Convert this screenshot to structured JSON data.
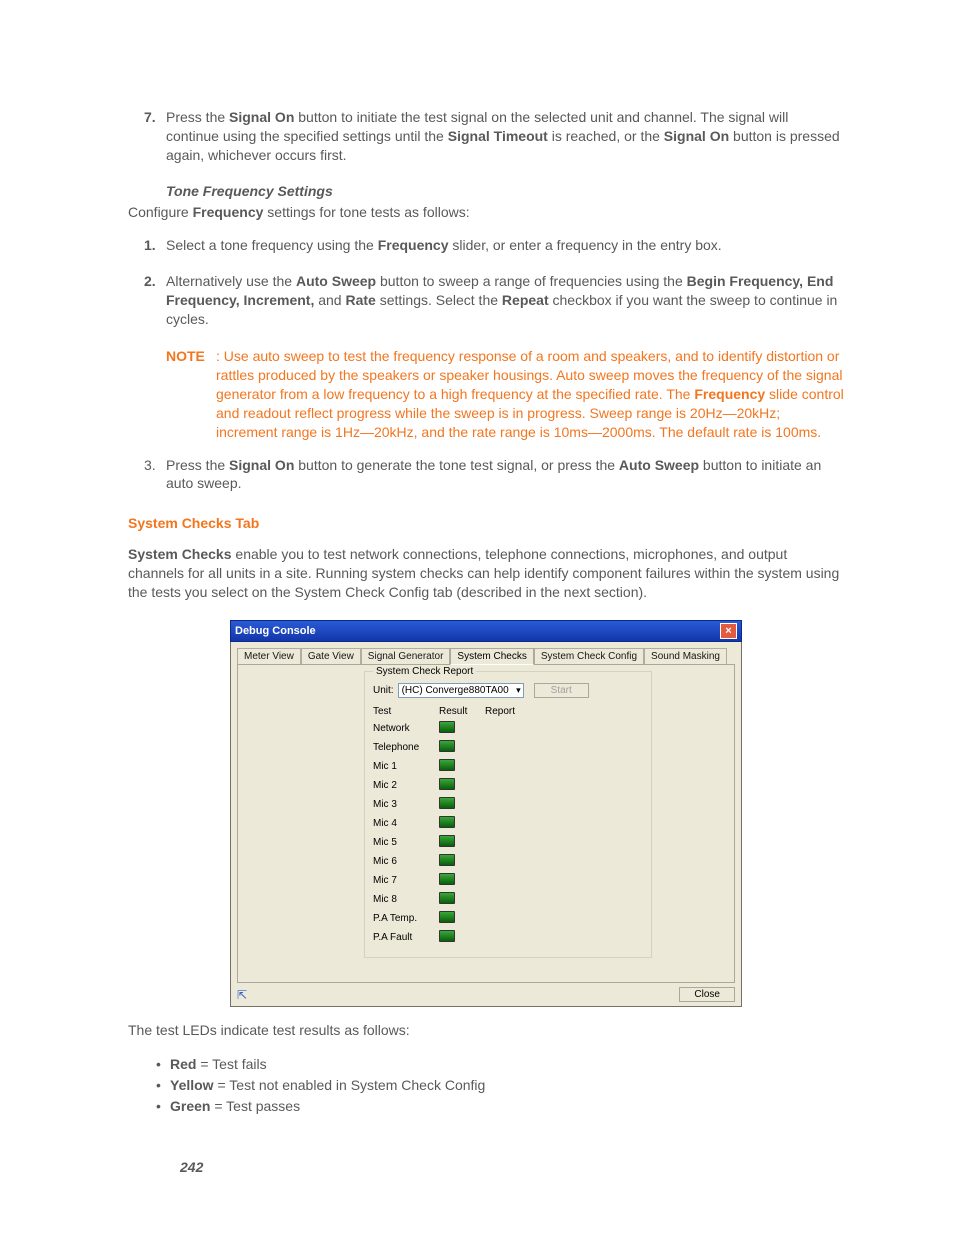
{
  "step7": {
    "num": "7.",
    "pre": "Press the ",
    "b1": "Signal On",
    "mid1": " button to initiate the test signal on the selected unit and channel. The signal will continue using the specified settings until the ",
    "b2": "Signal Timeout",
    "mid2": " is reached, or the ",
    "b3": "Signal On",
    "end": " button is pressed again, whichever occurs first."
  },
  "tone_head": "Tone Frequency Settings",
  "tone_intro": {
    "pre": "Configure ",
    "b": "Frequency",
    "post": " settings for tone tests as follows:"
  },
  "tone_steps": {
    "s1": {
      "num": "1.",
      "pre": "Select a tone frequency using the ",
      "b": "Frequency",
      "post": " slider, or enter a frequency in the entry box."
    },
    "s2": {
      "num": "2.",
      "pre": "Alternatively use the ",
      "b1": "Auto Sweep",
      "mid1": " button to sweep a range of frequencies using the ",
      "b2": "Begin Frequency, End Frequency, Increment,",
      "mid2": " and ",
      "b3": "Rate",
      "mid3": " settings. Select the ",
      "b4": "Repeat",
      "post": " checkbox if you want the sweep to continue in cycles."
    },
    "s3": {
      "num": "3.",
      "pre": "Press the ",
      "b1": "Signal On",
      "mid": " button to generate the tone test signal, or press the ",
      "b2": "Auto Sweep",
      "post": " button to initiate an auto sweep."
    }
  },
  "note": {
    "label": "NOTE",
    "colon": ": ",
    "p1": "Use auto sweep to test the frequency response of a room and speakers, and to identify distortion or rattles produced by the speakers or speaker housings. Auto sweep moves the frequency of the signal generator from a low frequency to a high frequency at the specified rate. The ",
    "b": "Frequency",
    "p2": " slide control and readout reflect progress while the sweep is in progress. Sweep range is 20Hz—20kHz; increment range is 1Hz—20kHz, and the rate range is 10ms—2000ms. The default rate is 100ms."
  },
  "sys_head": "System Checks Tab",
  "sys_para": {
    "b": "System Checks",
    "rest": " enable you to test network connections, telephone connections, microphones, and output channels for all units in a site. Running system checks can help identify component failures within the system using the tests you select on the System Check Config tab (described in the next section)."
  },
  "screenshot": {
    "title": "Debug Console",
    "tabs": [
      "Meter View",
      "Gate View",
      "Signal Generator",
      "System Checks",
      "System Check Config",
      "Sound Masking"
    ],
    "active_tab": 3,
    "groupbox_legend": "System Check Report",
    "unit_label": "Unit:",
    "unit_value": "(HC) Converge880TA00",
    "start_label": "Start",
    "col_test": "Test",
    "col_result": "Result",
    "col_report": "Report",
    "rows": [
      "Network",
      "Telephone",
      "Mic 1",
      "Mic 2",
      "Mic 3",
      "Mic 4",
      "Mic 5",
      "Mic 6",
      "Mic 7",
      "Mic 8",
      "P.A Temp.",
      "P.A Fault"
    ],
    "close_btn": "Close"
  },
  "led_intro": "The test LEDs indicate test results as follows:",
  "led_bullets": {
    "red": {
      "b": "Red",
      "rest": " = Test fails"
    },
    "yel": {
      "b": "Yellow",
      "rest": " = Test not enabled in System Check Config"
    },
    "grn": {
      "b": "Green",
      "rest": " = Test passes"
    }
  },
  "pagenum": "242"
}
